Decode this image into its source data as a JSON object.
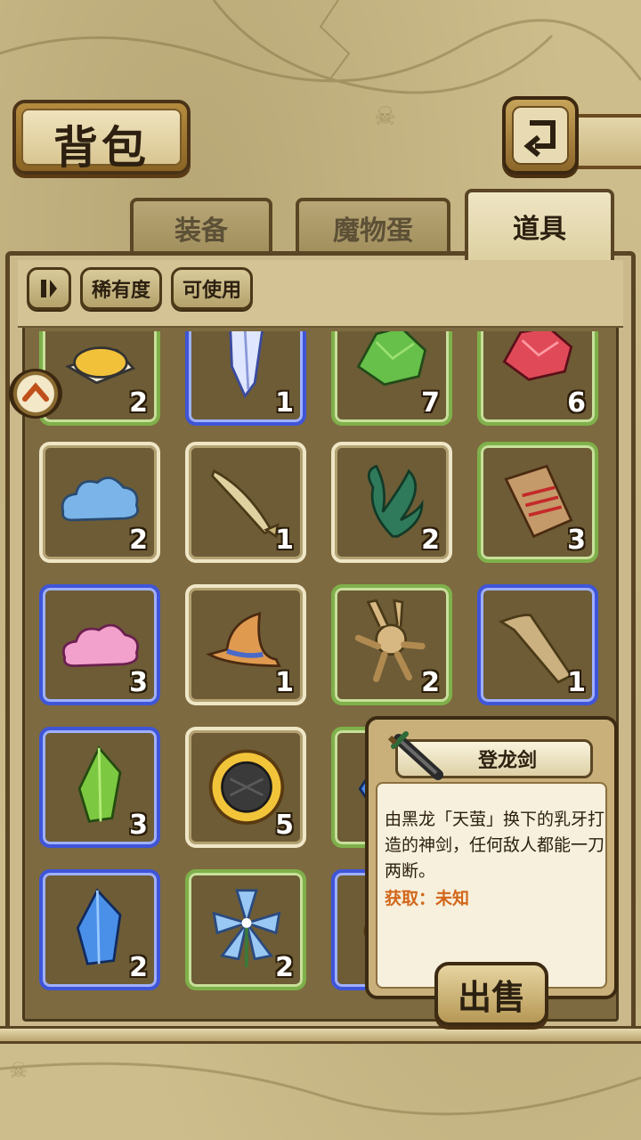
{
  "header": {
    "title": "背包"
  },
  "tabs": [
    {
      "label": "装备",
      "active": false
    },
    {
      "label": "魔物蛋",
      "active": false
    },
    {
      "label": "道具",
      "active": true
    }
  ],
  "filters": {
    "sort_icon": "pause-sort-icon",
    "rarity": "稀有度",
    "usable": "可使用"
  },
  "items": [
    {
      "icon": "grain-pile-icon",
      "count": "2",
      "rarity": "green"
    },
    {
      "icon": "crystal-shard-icon",
      "count": "1",
      "rarity": "blue"
    },
    {
      "icon": "green-ore-icon",
      "count": "7",
      "rarity": "green"
    },
    {
      "icon": "red-ore-icon",
      "count": "6",
      "rarity": "green"
    },
    {
      "icon": "blue-cloud-icon",
      "count": "2",
      "rarity": "white"
    },
    {
      "icon": "fish-icon",
      "count": "1",
      "rarity": "white"
    },
    {
      "icon": "seaweed-icon",
      "count": "2",
      "rarity": "white"
    },
    {
      "icon": "fish-bone-board-icon",
      "count": "3",
      "rarity": "green"
    },
    {
      "icon": "pink-cloud-icon",
      "count": "3",
      "rarity": "blue"
    },
    {
      "icon": "witch-hat-icon",
      "count": "1",
      "rarity": "white"
    },
    {
      "icon": "voodoo-doll-icon",
      "count": "2",
      "rarity": "green"
    },
    {
      "icon": "wooden-plank-icon",
      "count": "1",
      "rarity": "blue"
    },
    {
      "icon": "green-crystal-icon",
      "count": "3",
      "rarity": "blue"
    },
    {
      "icon": "sunflower-icon",
      "count": "5",
      "rarity": "white"
    },
    {
      "icon": "blue-gem-icon",
      "count": "",
      "rarity": "green"
    },
    {
      "icon": "empty-icon",
      "count": "",
      "rarity": "green"
    },
    {
      "icon": "blue-crystal-icon",
      "count": "2",
      "rarity": "blue"
    },
    {
      "icon": "blue-flower-icon",
      "count": "2",
      "rarity": "green"
    },
    {
      "icon": "gold-item-icon",
      "count": "",
      "rarity": "blue"
    },
    {
      "icon": "empty-icon",
      "count": "",
      "rarity": "blue"
    }
  ],
  "tooltip": {
    "name": "登龙剑",
    "description": "由黑龙「天萤」换下的乳牙打造的神剑，任何敌人都能一刀两断。",
    "obtain": "获取：未知",
    "icon": "sword-icon"
  },
  "sell_button": "出售",
  "colors": {
    "green": "#7fb04a",
    "blue": "#3f55d8",
    "white": "#efe6c6",
    "obtain": "#d2661a"
  }
}
